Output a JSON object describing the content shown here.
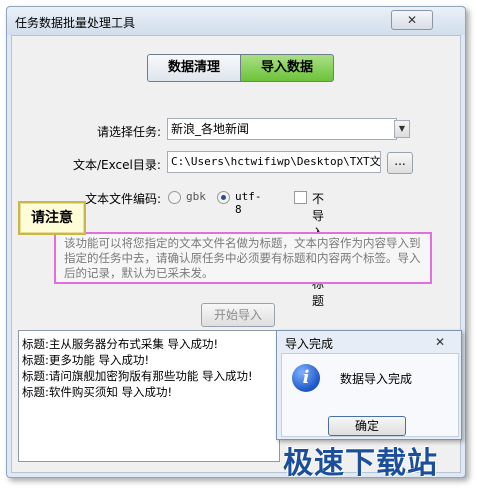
{
  "window": {
    "title": "任务数据批量处理工具",
    "close_glyph": "✕"
  },
  "tabs": {
    "clean": "数据清理",
    "import": "导入数据"
  },
  "form": {
    "task_label": "请选择任务:",
    "task_value": "新浪_各地新闻",
    "dir_label": "文本/Excel目录:",
    "dir_value": "C:\\Users\\hctwifiwp\\Desktop\\TXT文章",
    "browse_label": "...",
    "encoding_label": "文本文件编码:",
    "enc_gbk": "gbk",
    "enc_utf8": "utf-8",
    "selected_encoding": "utf-8",
    "no_dup_label": "不导入重复标题",
    "no_dup_checked": false
  },
  "notice": {
    "badge": "请注意",
    "text": "该功能可以将您指定的文本文件名做为标题，文本内容作为内容导入到指定的任务中去，请确认原任务中必须要有标题和内容两个标签。导入后的记录，默认为已采未发。"
  },
  "start_button": "开始导入",
  "log": [
    "标题:主从服务器分布式采集 导入成功!",
    "标题:更多功能 导入成功!",
    "标题:请问旗舰加密狗版有那些功能 导入成功!",
    "标题:软件购买须知 导入成功!"
  ],
  "dialog": {
    "title": "导入完成",
    "close_glyph": "✕",
    "message": "数据导入完成",
    "ok": "确定",
    "icon": "info-icon"
  },
  "watermark": "极速下载站"
}
